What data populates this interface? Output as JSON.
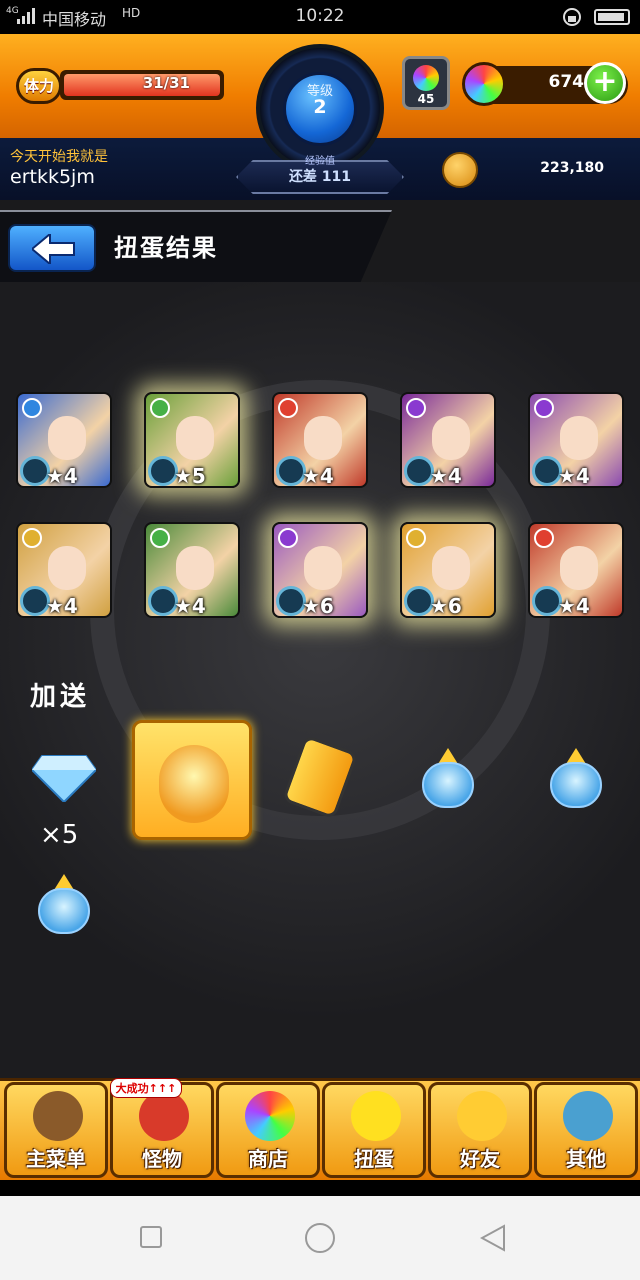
{
  "status_bar": {
    "network": "4G",
    "carrier": "中国移动",
    "hd": "HD",
    "time": "10:22"
  },
  "header": {
    "stamina_label": "体力",
    "stamina_value": "31/31",
    "stamina_fraction": 1.0,
    "level_label": "等级",
    "level_value": "2",
    "exp_label": "经验值",
    "exp_value": "还差 111",
    "slot_count": "45",
    "gem_count": "674",
    "greeting": "今天开始我就是",
    "username": "ertkk5jm",
    "money": "223,180"
  },
  "page": {
    "title": "扭蛋结果"
  },
  "results": [
    {
      "stars": "★4",
      "element": "water",
      "glow": false,
      "color": "#3a6ad0"
    },
    {
      "stars": "★5",
      "element": "wood",
      "glow": true,
      "color": "#6aa03a"
    },
    {
      "stars": "★4",
      "element": "fire",
      "glow": false,
      "color": "#c03a2a"
    },
    {
      "stars": "★4",
      "element": "dark",
      "glow": false,
      "color": "#7a2a9a"
    },
    {
      "stars": "★4",
      "element": "dark",
      "glow": false,
      "color": "#8a4ab0"
    },
    {
      "stars": "★4",
      "element": "light",
      "glow": false,
      "color": "#d0a040"
    },
    {
      "stars": "★4",
      "element": "wood",
      "glow": false,
      "color": "#4a8a3a"
    },
    {
      "stars": "★6",
      "element": "dark",
      "glow": true,
      "color": "#9a5ac0"
    },
    {
      "stars": "★6",
      "element": "light",
      "glow": true,
      "color": "#e0a030"
    },
    {
      "stars": "★4",
      "element": "fire",
      "glow": false,
      "color": "#c03a2a"
    }
  ],
  "bonus": {
    "label": "加送",
    "gem_count": "×5"
  },
  "nav": [
    {
      "label": "主菜单",
      "icon": "castle-icon"
    },
    {
      "label": "怪物",
      "icon": "dragon-icon"
    },
    {
      "label": "商店",
      "icon": "rainbow-orb-icon"
    },
    {
      "label": "扭蛋",
      "icon": "egg-icon"
    },
    {
      "label": "好友",
      "icon": "friends-icon"
    },
    {
      "label": "其他",
      "icon": "other-icon"
    }
  ],
  "nav_badge": "大成功↑↑↑",
  "colors": {
    "header_orange": "#f07d00",
    "header_navy": "#0c1b3c",
    "back_button_blue": "#1356c8",
    "element_colors": {
      "water": "#2f86e0",
      "wood": "#46b046",
      "fire": "#e04030",
      "dark": "#8a3ad0",
      "light": "#e0b030"
    }
  }
}
